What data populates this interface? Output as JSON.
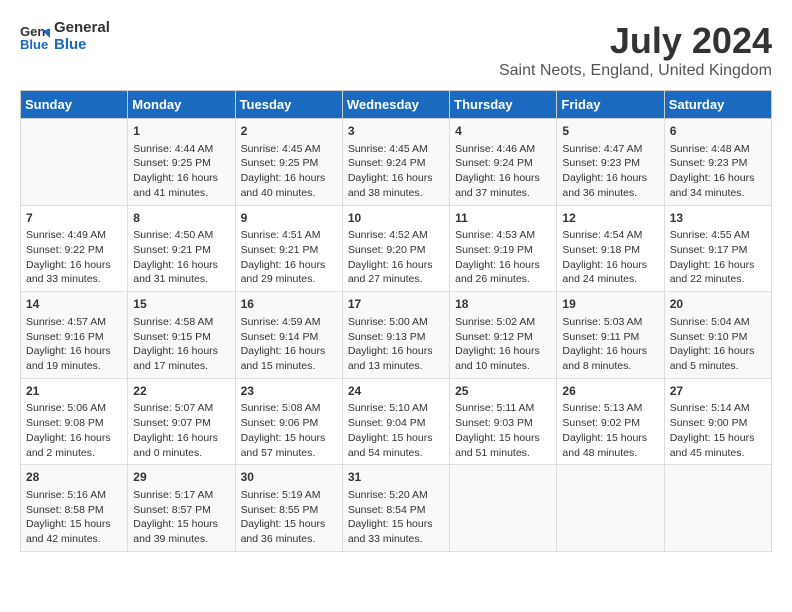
{
  "header": {
    "logo_line1": "General",
    "logo_line2": "Blue",
    "main_title": "July 2024",
    "subtitle": "Saint Neots, England, United Kingdom"
  },
  "days_of_week": [
    "Sunday",
    "Monday",
    "Tuesday",
    "Wednesday",
    "Thursday",
    "Friday",
    "Saturday"
  ],
  "weeks": [
    [
      {
        "day": "",
        "content": ""
      },
      {
        "day": "1",
        "content": "Sunrise: 4:44 AM\nSunset: 9:25 PM\nDaylight: 16 hours\nand 41 minutes."
      },
      {
        "day": "2",
        "content": "Sunrise: 4:45 AM\nSunset: 9:25 PM\nDaylight: 16 hours\nand 40 minutes."
      },
      {
        "day": "3",
        "content": "Sunrise: 4:45 AM\nSunset: 9:24 PM\nDaylight: 16 hours\nand 38 minutes."
      },
      {
        "day": "4",
        "content": "Sunrise: 4:46 AM\nSunset: 9:24 PM\nDaylight: 16 hours\nand 37 minutes."
      },
      {
        "day": "5",
        "content": "Sunrise: 4:47 AM\nSunset: 9:23 PM\nDaylight: 16 hours\nand 36 minutes."
      },
      {
        "day": "6",
        "content": "Sunrise: 4:48 AM\nSunset: 9:23 PM\nDaylight: 16 hours\nand 34 minutes."
      }
    ],
    [
      {
        "day": "7",
        "content": "Sunrise: 4:49 AM\nSunset: 9:22 PM\nDaylight: 16 hours\nand 33 minutes."
      },
      {
        "day": "8",
        "content": "Sunrise: 4:50 AM\nSunset: 9:21 PM\nDaylight: 16 hours\nand 31 minutes."
      },
      {
        "day": "9",
        "content": "Sunrise: 4:51 AM\nSunset: 9:21 PM\nDaylight: 16 hours\nand 29 minutes."
      },
      {
        "day": "10",
        "content": "Sunrise: 4:52 AM\nSunset: 9:20 PM\nDaylight: 16 hours\nand 27 minutes."
      },
      {
        "day": "11",
        "content": "Sunrise: 4:53 AM\nSunset: 9:19 PM\nDaylight: 16 hours\nand 26 minutes."
      },
      {
        "day": "12",
        "content": "Sunrise: 4:54 AM\nSunset: 9:18 PM\nDaylight: 16 hours\nand 24 minutes."
      },
      {
        "day": "13",
        "content": "Sunrise: 4:55 AM\nSunset: 9:17 PM\nDaylight: 16 hours\nand 22 minutes."
      }
    ],
    [
      {
        "day": "14",
        "content": "Sunrise: 4:57 AM\nSunset: 9:16 PM\nDaylight: 16 hours\nand 19 minutes."
      },
      {
        "day": "15",
        "content": "Sunrise: 4:58 AM\nSunset: 9:15 PM\nDaylight: 16 hours\nand 17 minutes."
      },
      {
        "day": "16",
        "content": "Sunrise: 4:59 AM\nSunset: 9:14 PM\nDaylight: 16 hours\nand 15 minutes."
      },
      {
        "day": "17",
        "content": "Sunrise: 5:00 AM\nSunset: 9:13 PM\nDaylight: 16 hours\nand 13 minutes."
      },
      {
        "day": "18",
        "content": "Sunrise: 5:02 AM\nSunset: 9:12 PM\nDaylight: 16 hours\nand 10 minutes."
      },
      {
        "day": "19",
        "content": "Sunrise: 5:03 AM\nSunset: 9:11 PM\nDaylight: 16 hours\nand 8 minutes."
      },
      {
        "day": "20",
        "content": "Sunrise: 5:04 AM\nSunset: 9:10 PM\nDaylight: 16 hours\nand 5 minutes."
      }
    ],
    [
      {
        "day": "21",
        "content": "Sunrise: 5:06 AM\nSunset: 9:08 PM\nDaylight: 16 hours\nand 2 minutes."
      },
      {
        "day": "22",
        "content": "Sunrise: 5:07 AM\nSunset: 9:07 PM\nDaylight: 16 hours\nand 0 minutes."
      },
      {
        "day": "23",
        "content": "Sunrise: 5:08 AM\nSunset: 9:06 PM\nDaylight: 15 hours\nand 57 minutes."
      },
      {
        "day": "24",
        "content": "Sunrise: 5:10 AM\nSunset: 9:04 PM\nDaylight: 15 hours\nand 54 minutes."
      },
      {
        "day": "25",
        "content": "Sunrise: 5:11 AM\nSunset: 9:03 PM\nDaylight: 15 hours\nand 51 minutes."
      },
      {
        "day": "26",
        "content": "Sunrise: 5:13 AM\nSunset: 9:02 PM\nDaylight: 15 hours\nand 48 minutes."
      },
      {
        "day": "27",
        "content": "Sunrise: 5:14 AM\nSunset: 9:00 PM\nDaylight: 15 hours\nand 45 minutes."
      }
    ],
    [
      {
        "day": "28",
        "content": "Sunrise: 5:16 AM\nSunset: 8:58 PM\nDaylight: 15 hours\nand 42 minutes."
      },
      {
        "day": "29",
        "content": "Sunrise: 5:17 AM\nSunset: 8:57 PM\nDaylight: 15 hours\nand 39 minutes."
      },
      {
        "day": "30",
        "content": "Sunrise: 5:19 AM\nSunset: 8:55 PM\nDaylight: 15 hours\nand 36 minutes."
      },
      {
        "day": "31",
        "content": "Sunrise: 5:20 AM\nSunset: 8:54 PM\nDaylight: 15 hours\nand 33 minutes."
      },
      {
        "day": "",
        "content": ""
      },
      {
        "day": "",
        "content": ""
      },
      {
        "day": "",
        "content": ""
      }
    ]
  ]
}
